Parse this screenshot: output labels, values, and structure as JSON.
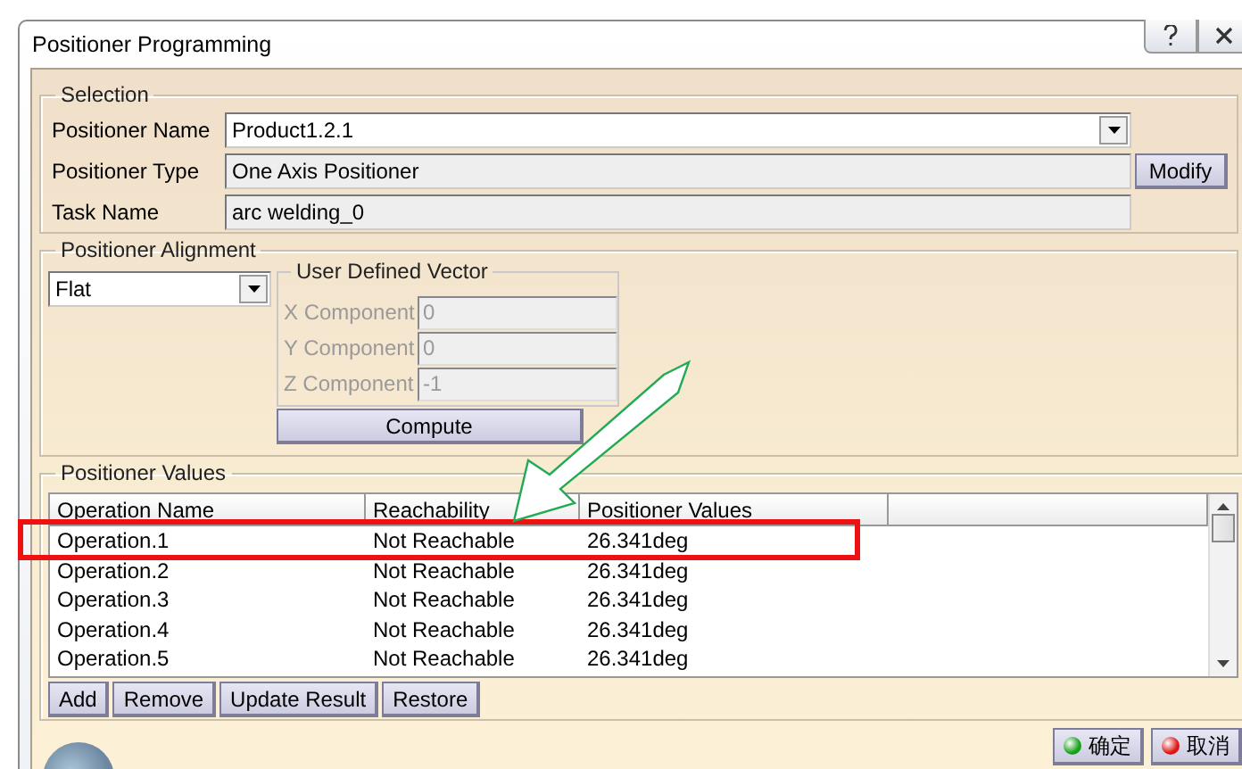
{
  "window": {
    "title": "Positioner Programming"
  },
  "selection": {
    "title": "Selection",
    "fields": [
      {
        "label": "Positioner Name",
        "value": "Product1.2.1",
        "kind": "dropdown"
      },
      {
        "label": "Positioner Type",
        "value": "One Axis Positioner",
        "kind": "readonly"
      },
      {
        "label": "Task Name",
        "value": "arc welding_0",
        "kind": "readonly"
      }
    ],
    "modify_button": "Modify"
  },
  "alignment": {
    "title": "Positioner Alignment",
    "mode": "Flat",
    "vector": {
      "title": "User Defined Vector",
      "disabled": true,
      "components": [
        {
          "label": "X Component",
          "value": "0"
        },
        {
          "label": "Y Component",
          "value": "0"
        },
        {
          "label": "Z Component",
          "value": "-1"
        }
      ]
    },
    "compute_button": "Compute"
  },
  "values": {
    "title": "Positioner Values",
    "columns": [
      "Operation Name",
      "Reachability",
      "Positioner Values"
    ],
    "rows": [
      {
        "cells": [
          "Operation.1",
          "Not Reachable",
          "26.341deg"
        ],
        "highlighted": true
      },
      {
        "cells": [
          "Operation.2",
          "Not Reachable",
          "26.341deg"
        ],
        "highlighted": false
      },
      {
        "cells": [
          "Operation.3",
          "Not Reachable",
          "26.341deg"
        ],
        "highlighted": false
      },
      {
        "cells": [
          "Operation.4",
          "Not Reachable",
          "26.341deg"
        ],
        "highlighted": false
      },
      {
        "cells": [
          "Operation.5",
          "Not Reachable",
          "26.341deg"
        ],
        "highlighted": false
      }
    ],
    "buttons": [
      "Add",
      "Remove",
      "Update Result",
      "Restore"
    ]
  },
  "footer_buttons": [
    {
      "label": "确定",
      "kind": "ok"
    },
    {
      "label": "取消",
      "kind": "cancel"
    }
  ]
}
